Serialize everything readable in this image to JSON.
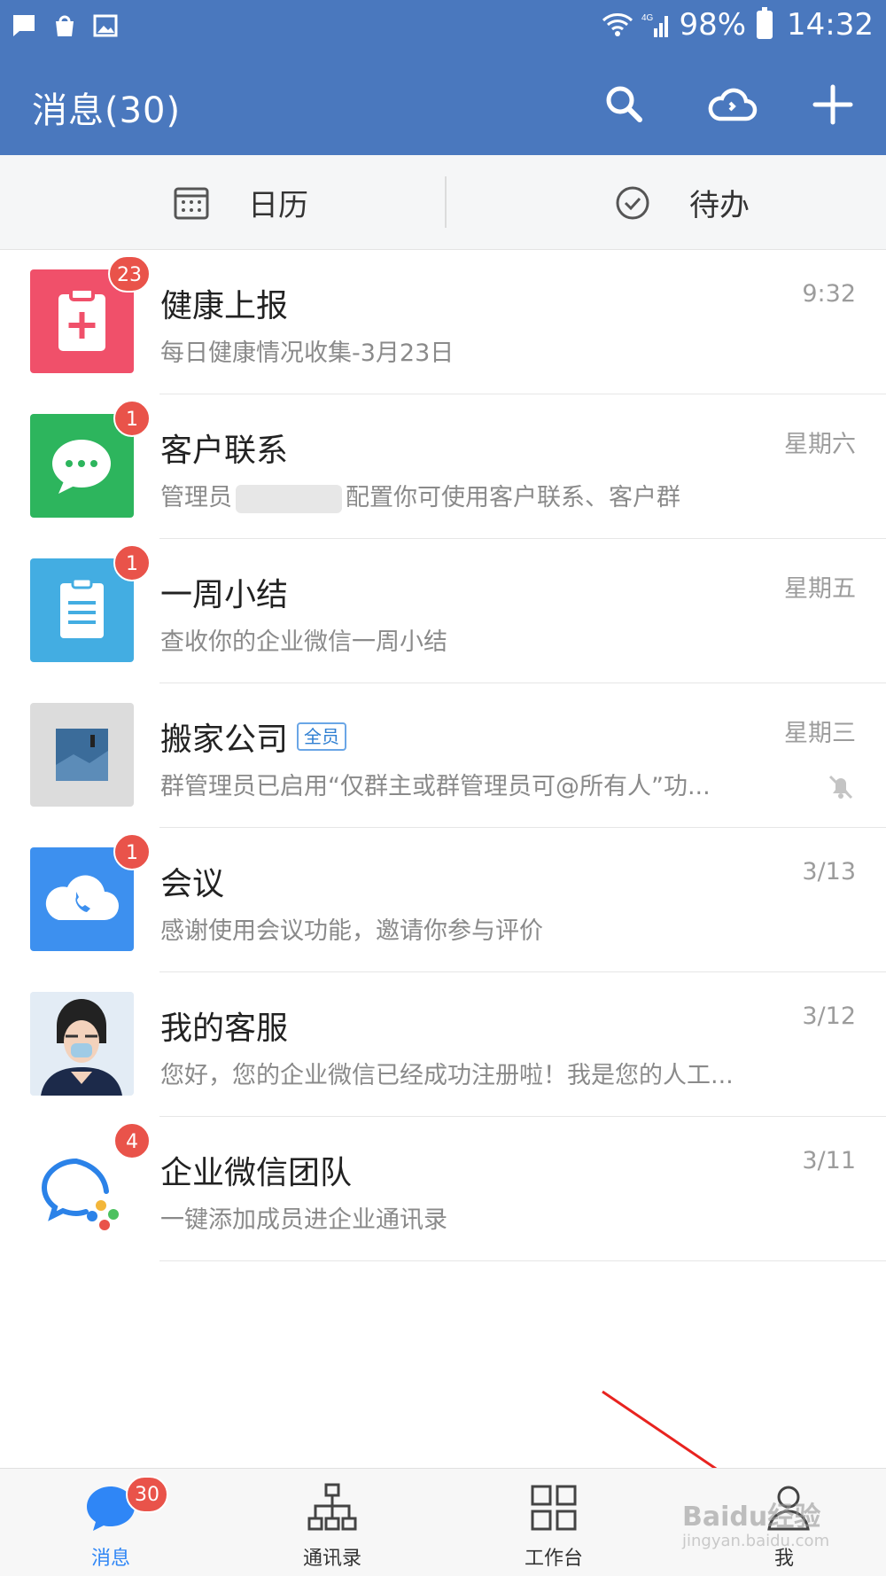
{
  "status_bar": {
    "battery": "98%",
    "time": "14:32",
    "network": "4G"
  },
  "header": {
    "title": "消息(30)"
  },
  "quick_bar": {
    "calendar_label": "日历",
    "todo_label": "待办"
  },
  "messages": [
    {
      "title": "健康上报",
      "subtitle": "每日健康情况收集-3月23日",
      "time": "9:32",
      "badge": "23"
    },
    {
      "title": "客户联系",
      "subtitle_prefix": "管理员",
      "subtitle_suffix": "配置你可使用客户联系、客户群",
      "time": "星期六",
      "badge": "1"
    },
    {
      "title": "一周小结",
      "subtitle": "查收你的企业微信一周小结",
      "time": "星期五",
      "badge": "1"
    },
    {
      "title": "搬家公司",
      "tag": "全员",
      "subtitle": "群管理员已启用“仅群主或群管理员可@所有人”功...",
      "time": "星期三"
    },
    {
      "title": "会议",
      "subtitle": "感谢使用会议功能，邀请你参与评价",
      "time": "3/13",
      "badge": "1"
    },
    {
      "title": "我的客服",
      "subtitle": "您好，您的企业微信已经成功注册啦！我是您的人工...",
      "time": "3/12"
    },
    {
      "title": "企业微信团队",
      "subtitle": "一键添加成员进企业通讯录",
      "time": "3/11",
      "badge": "4"
    }
  ],
  "bottom_nav": {
    "messages_label": "消息",
    "messages_badge": "30",
    "contacts_label": "通讯录",
    "workbench_label": "工作台",
    "me_label": "我"
  },
  "watermark": {
    "main": "Baidu经验",
    "sub": "jingyan.baidu.com"
  },
  "colors": {
    "header": "#4a78be",
    "badge": "#e9534a",
    "accent": "#2f86f6"
  }
}
